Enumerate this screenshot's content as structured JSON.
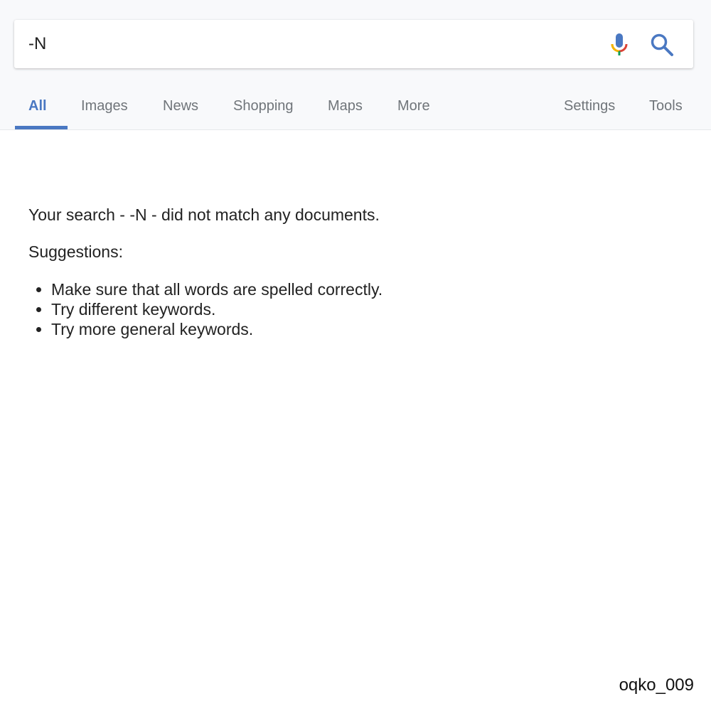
{
  "search": {
    "query": "-N",
    "icons": [
      "microphone-icon",
      "search-icon"
    ]
  },
  "tabs": [
    {
      "label": "All",
      "active": true
    },
    {
      "label": "Images"
    },
    {
      "label": "News"
    },
    {
      "label": "Shopping"
    },
    {
      "label": "Maps"
    },
    {
      "label": "More"
    }
  ],
  "right_tabs": [
    {
      "label": "Settings"
    },
    {
      "label": "Tools"
    }
  ],
  "results": {
    "message": "Your search - -N - did not match any documents.",
    "suggestions_label": "Suggestions:",
    "suggestions": [
      "Make sure that all words are spelled correctly.",
      "Try different keywords.",
      "Try more general keywords."
    ]
  },
  "watermark": "oqko_009",
  "colors": {
    "accent": "#4a78c2"
  }
}
